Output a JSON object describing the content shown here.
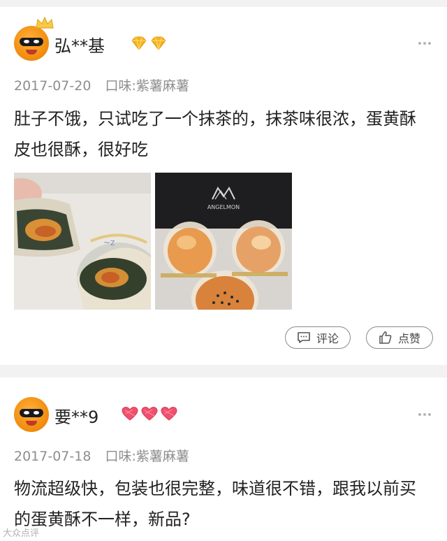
{
  "reviews": [
    {
      "username": "弘**基",
      "date": "2017-07-20",
      "flavor": "口味:紫薯麻薯",
      "content": "肚子不饿，只试吃了一个抹茶的，抹茶味很浓，蛋黄酥皮也很酥，很好吃",
      "badge_icon": "gold-diamond-icon",
      "badge_count": 2,
      "badge_color": "#f6b21b",
      "photos": [
        {
          "icon": "matcha-yolk-pastry-photo"
        },
        {
          "icon": "angelmon-pastry-box-photo",
          "brand_text": "ANGELMON"
        }
      ],
      "actions": {
        "comment_label": "评论",
        "like_label": "点赞"
      }
    },
    {
      "username": "要**9",
      "date": "2017-07-18",
      "flavor": "口味:紫薯麻薯",
      "content": "物流超级快，包装也很完整，味道很不错，跟我以前买的蛋黄酥不一样，新品?",
      "badge_icon": "red-heart-icon",
      "badge_count": 3,
      "badge_color": "#f0506e"
    }
  ],
  "watermark": "大众点评",
  "colors": {
    "background": "#f2f2f2",
    "card": "#ffffff",
    "meta_text": "#8e8e8e",
    "avatar_orange": "#f08a0c"
  }
}
